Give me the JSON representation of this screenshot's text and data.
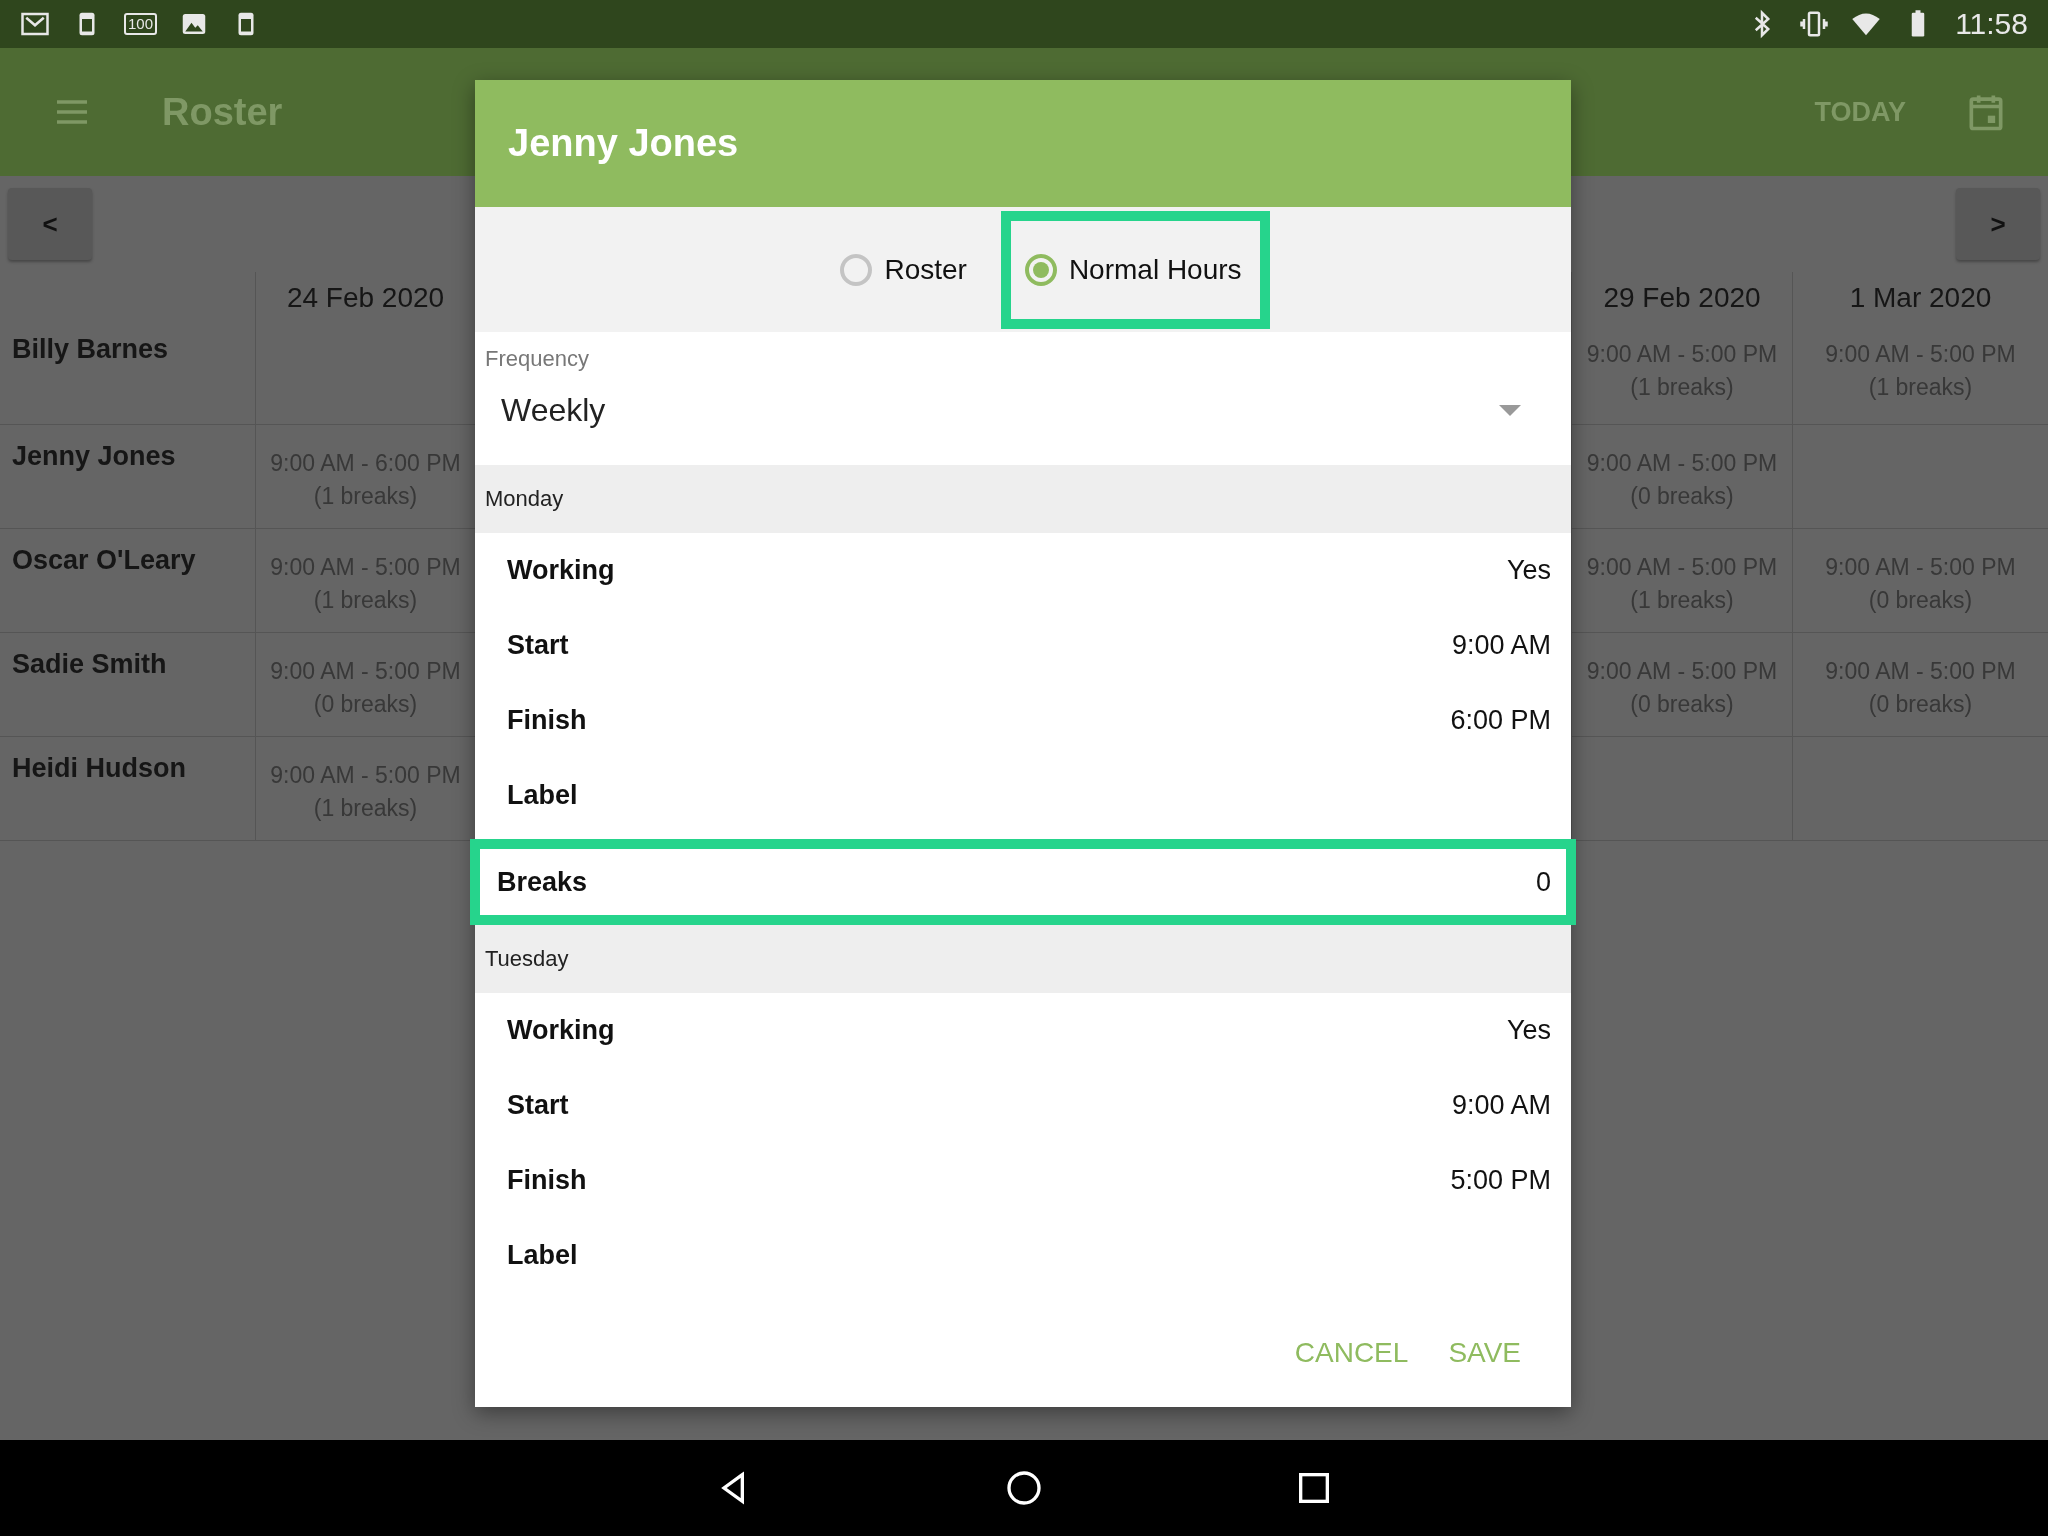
{
  "status_bar": {
    "badge": "100",
    "time": "11:58"
  },
  "app_bar": {
    "title": "Roster",
    "action": "TODAY"
  },
  "pager": {
    "prev": "<",
    "next": ">"
  },
  "roster": {
    "columns": [
      {
        "date": "24 Feb 2020"
      },
      {
        "date": "29 Feb 2020"
      },
      {
        "date": "1 Mar 2020"
      }
    ],
    "rows": [
      {
        "name": "Billy Barnes",
        "cells": [
          null,
          {
            "time": "9:00 AM - 5:00 PM",
            "breaks": "(1 breaks)"
          },
          {
            "time": "9:00 AM - 5:00 PM",
            "breaks": "(1 breaks)"
          }
        ]
      },
      {
        "name": "Jenny Jones",
        "cells": [
          {
            "time": "9:00 AM - 6:00 PM",
            "breaks": "(1 breaks)"
          },
          {
            "time": "9:00 AM - 5:00 PM",
            "breaks": "(0 breaks)"
          },
          null
        ]
      },
      {
        "name": "Oscar O'Leary",
        "cells": [
          {
            "time": "9:00 AM - 5:00 PM",
            "breaks": "(1 breaks)"
          },
          {
            "time": "9:00 AM - 5:00 PM",
            "breaks": "(1 breaks)"
          },
          {
            "time": "9:00 AM - 5:00 PM",
            "breaks": "(0 breaks)"
          }
        ]
      },
      {
        "name": "Sadie Smith",
        "cells": [
          {
            "time": "9:00 AM - 5:00 PM",
            "breaks": "(0 breaks)"
          },
          {
            "time": "9:00 AM - 5:00 PM",
            "breaks": "(0 breaks)"
          },
          {
            "time": "9:00 AM - 5:00 PM",
            "breaks": "(0 breaks)"
          }
        ]
      },
      {
        "name": "Heidi Hudson",
        "cells": [
          {
            "time": "9:00 AM - 5:00 PM",
            "breaks": "(1 breaks)"
          },
          null,
          null
        ]
      }
    ]
  },
  "dialog": {
    "title": "Jenny Jones",
    "modes": [
      {
        "label": "Roster",
        "selected": false,
        "highlighted": false
      },
      {
        "label": "Normal Hours",
        "selected": true,
        "highlighted": true
      }
    ],
    "frequency": {
      "label": "Frequency",
      "value": "Weekly"
    },
    "days": [
      {
        "day": "Monday",
        "fields": [
          {
            "label": "Working",
            "value": "Yes",
            "highlighted": false
          },
          {
            "label": "Start",
            "value": "9:00 AM",
            "highlighted": false
          },
          {
            "label": "Finish",
            "value": "6:00 PM",
            "highlighted": false
          },
          {
            "label": "Label",
            "highlighted": false
          },
          {
            "label": "Breaks",
            "value": "0",
            "highlighted": true
          }
        ]
      },
      {
        "day": "Tuesday",
        "fields": [
          {
            "label": "Working",
            "value": "Yes",
            "highlighted": false
          },
          {
            "label": "Start",
            "value": "9:00 AM",
            "highlighted": false
          },
          {
            "label": "Finish",
            "value": "5:00 PM",
            "highlighted": false
          },
          {
            "label": "Label",
            "highlighted": false
          }
        ]
      }
    ],
    "buttons": [
      "CANCEL",
      "SAVE"
    ]
  }
}
